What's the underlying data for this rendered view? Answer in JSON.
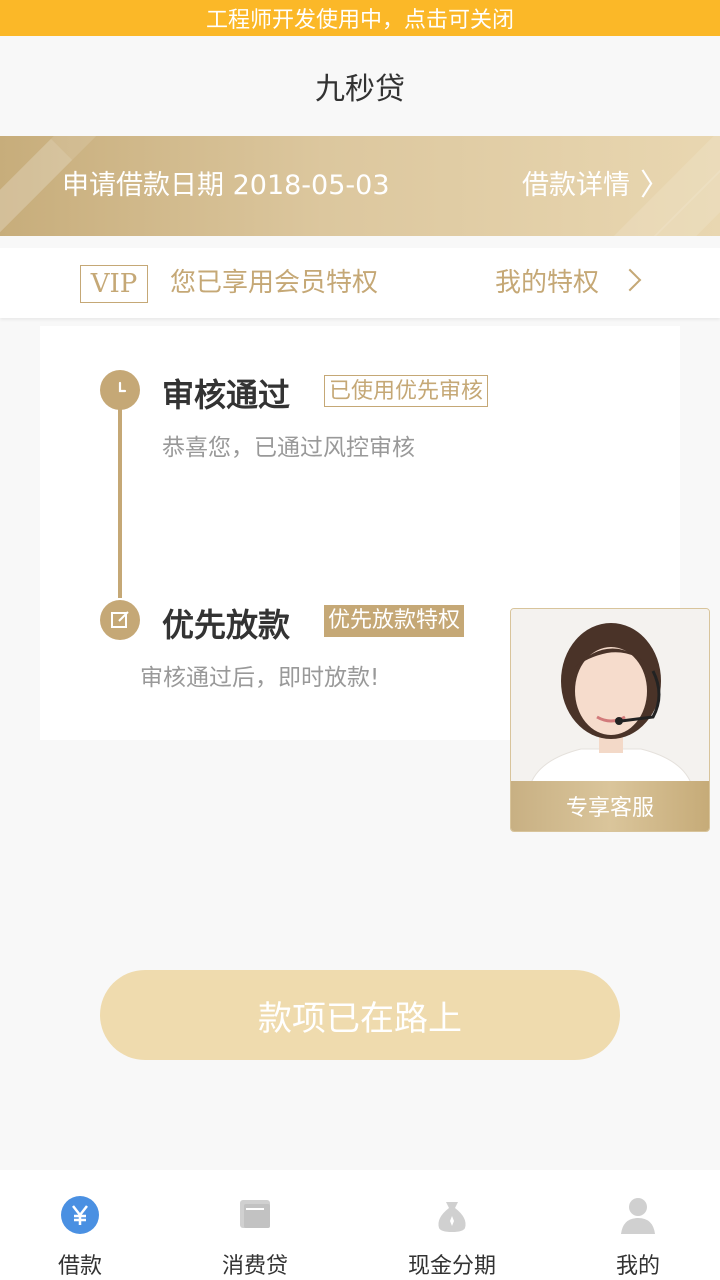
{
  "dev_banner": {
    "text": "工程师开发使用中，点击可关闭"
  },
  "header": {
    "title": "九秒贷"
  },
  "loan_banner": {
    "date_text": "申请借款日期 2018-05-03",
    "detail_label": "借款详情",
    "chevron": "〉"
  },
  "vip": {
    "badge": "VIP",
    "message": "您已享用会员特权",
    "link_label": "我的特权"
  },
  "steps": [
    {
      "title": "审核通过",
      "tag": "已使用优先审核",
      "desc": "恭喜您，已通过风控审核",
      "icon": "clock-icon"
    },
    {
      "title": "优先放款",
      "tag": "优先放款特权",
      "desc": "审核通过后，即时放款!",
      "icon": "edit-icon"
    }
  ],
  "customer_service": {
    "label": "专享客服"
  },
  "status_button": {
    "label": "款项已在路上"
  },
  "tabs": [
    {
      "label": "借款",
      "icon": "yen-icon",
      "active": true
    },
    {
      "label": "消费贷",
      "icon": "card-icon",
      "active": false
    },
    {
      "label": "现金分期",
      "icon": "money-bag-icon",
      "active": false
    },
    {
      "label": "我的",
      "icon": "user-icon",
      "active": false
    }
  ],
  "colors": {
    "gold": "#c5a876",
    "dev_bar": "#fbb828",
    "button": "#efdbae",
    "active_tab": "#4a90e2",
    "inactive_tab": "#d0d0d0"
  }
}
